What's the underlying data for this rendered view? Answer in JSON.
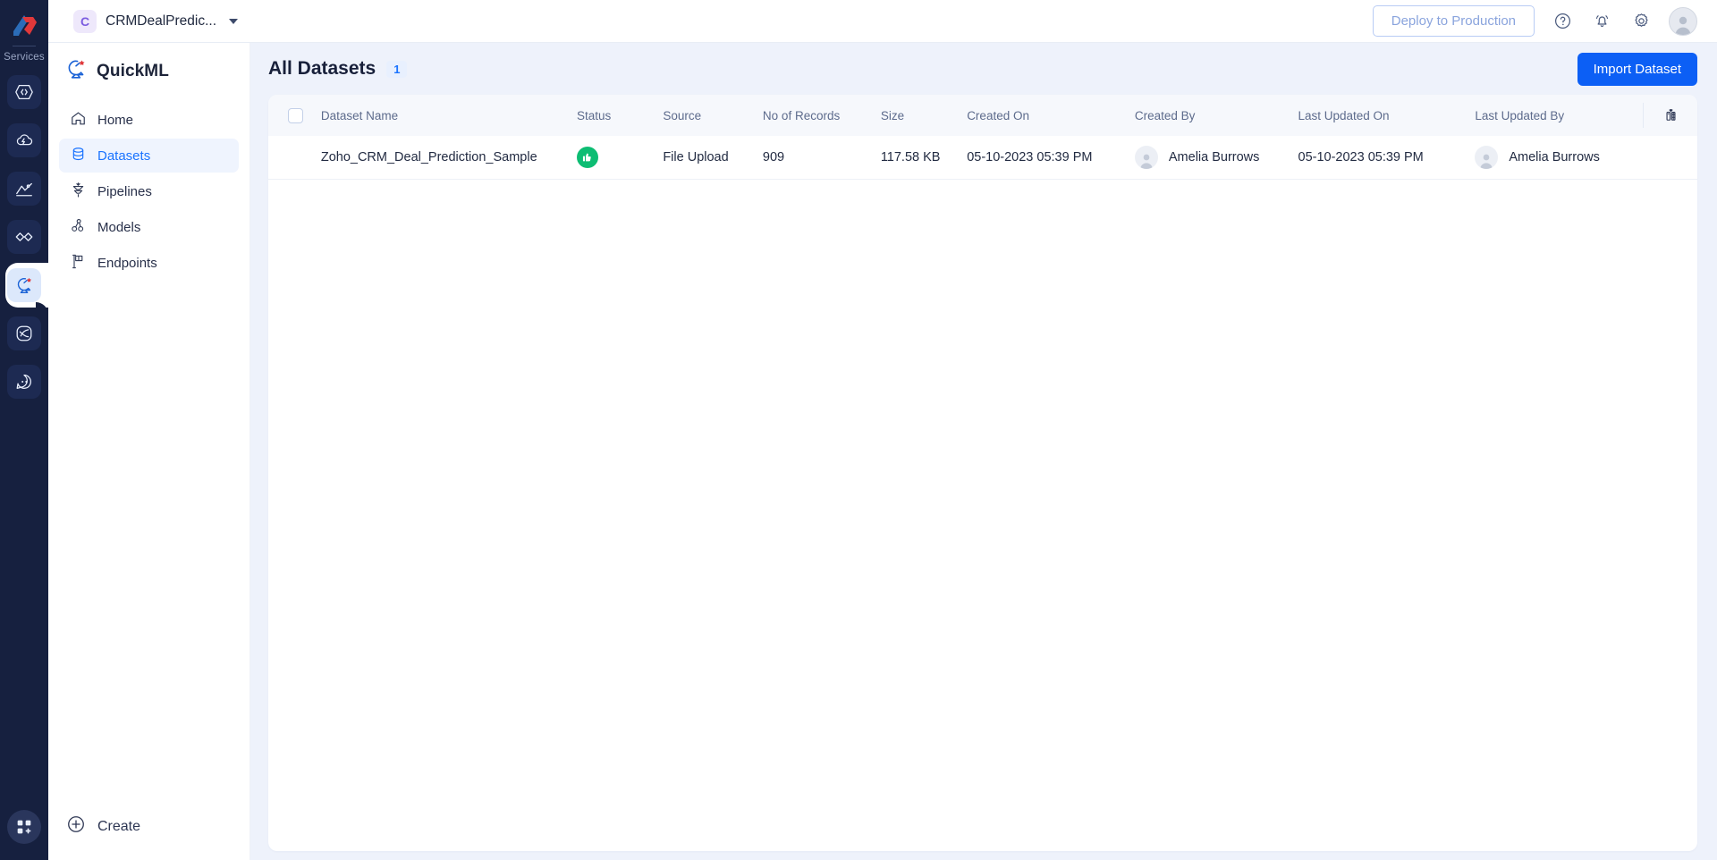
{
  "rail": {
    "logo_name": "zoho-logo",
    "services_label": "Services",
    "items": [
      {
        "name": "rail-item-code",
        "icon": "code-brackets-icon",
        "active": false
      },
      {
        "name": "rail-item-cloud",
        "icon": "cloud-flash-icon",
        "active": false
      },
      {
        "name": "rail-item-analytics",
        "icon": "analytics-chart-icon",
        "active": false
      },
      {
        "name": "rail-item-flow",
        "icon": "flow-diamond-icon",
        "active": false
      },
      {
        "name": "rail-item-quickml",
        "icon": "quickml-satellite-icon",
        "active": true
      },
      {
        "name": "rail-item-orbit",
        "icon": "orbit-icon",
        "active": false
      },
      {
        "name": "rail-item-chat",
        "icon": "chat-bubble-icon",
        "active": false
      }
    ],
    "bottom_item": {
      "name": "rail-item-apps",
      "icon": "apps-grid-plus-icon"
    }
  },
  "topbar": {
    "project_initial": "C",
    "project_name": "CRMDealPredic...",
    "deploy_label": "Deploy to Production",
    "help_icon": "help-circle-icon",
    "notification_icon": "bell-icon",
    "settings_icon": "gear-icon",
    "avatar_icon": "user-avatar-icon"
  },
  "sidebar": {
    "brand": "QuickML",
    "brand_icon": "quickml-satellite-icon",
    "items": [
      {
        "label": "Home",
        "icon": "home-icon",
        "active": false
      },
      {
        "label": "Datasets",
        "icon": "database-icon",
        "active": true
      },
      {
        "label": "Pipelines",
        "icon": "funnel-icon",
        "active": false
      },
      {
        "label": "Models",
        "icon": "models-nodes-icon",
        "active": false
      },
      {
        "label": "Endpoints",
        "icon": "flag-icon",
        "active": false
      }
    ],
    "create_label": "Create",
    "create_icon": "plus-circle-icon"
  },
  "main": {
    "title": "All Datasets",
    "count": "1",
    "import_label": "Import Dataset",
    "table": {
      "columns": [
        "Dataset Name",
        "Status",
        "Source",
        "No of Records",
        "Size",
        "Created On",
        "Created By",
        "Last Updated On",
        "Last Updated By"
      ],
      "settings_icon": "column-settings-icon",
      "rows": [
        {
          "dataset_name": "Zoho_CRM_Deal_Prediction_Sample",
          "status": "success",
          "status_icon": "thumbs-up-icon",
          "source": "File Upload",
          "records": "909",
          "size": "117.58 KB",
          "created_on": "05-10-2023 05:39 PM",
          "created_by": "Amelia Burrows",
          "last_updated_on": "05-10-2023 05:39 PM",
          "last_updated_by": "Amelia Burrows"
        }
      ]
    }
  },
  "colors": {
    "rail_bg": "#16203f",
    "accent": "#0c5ff5",
    "active_nav": "#1a73ff",
    "status_green": "#0dbd73",
    "page_bg": "#eef2fb"
  }
}
